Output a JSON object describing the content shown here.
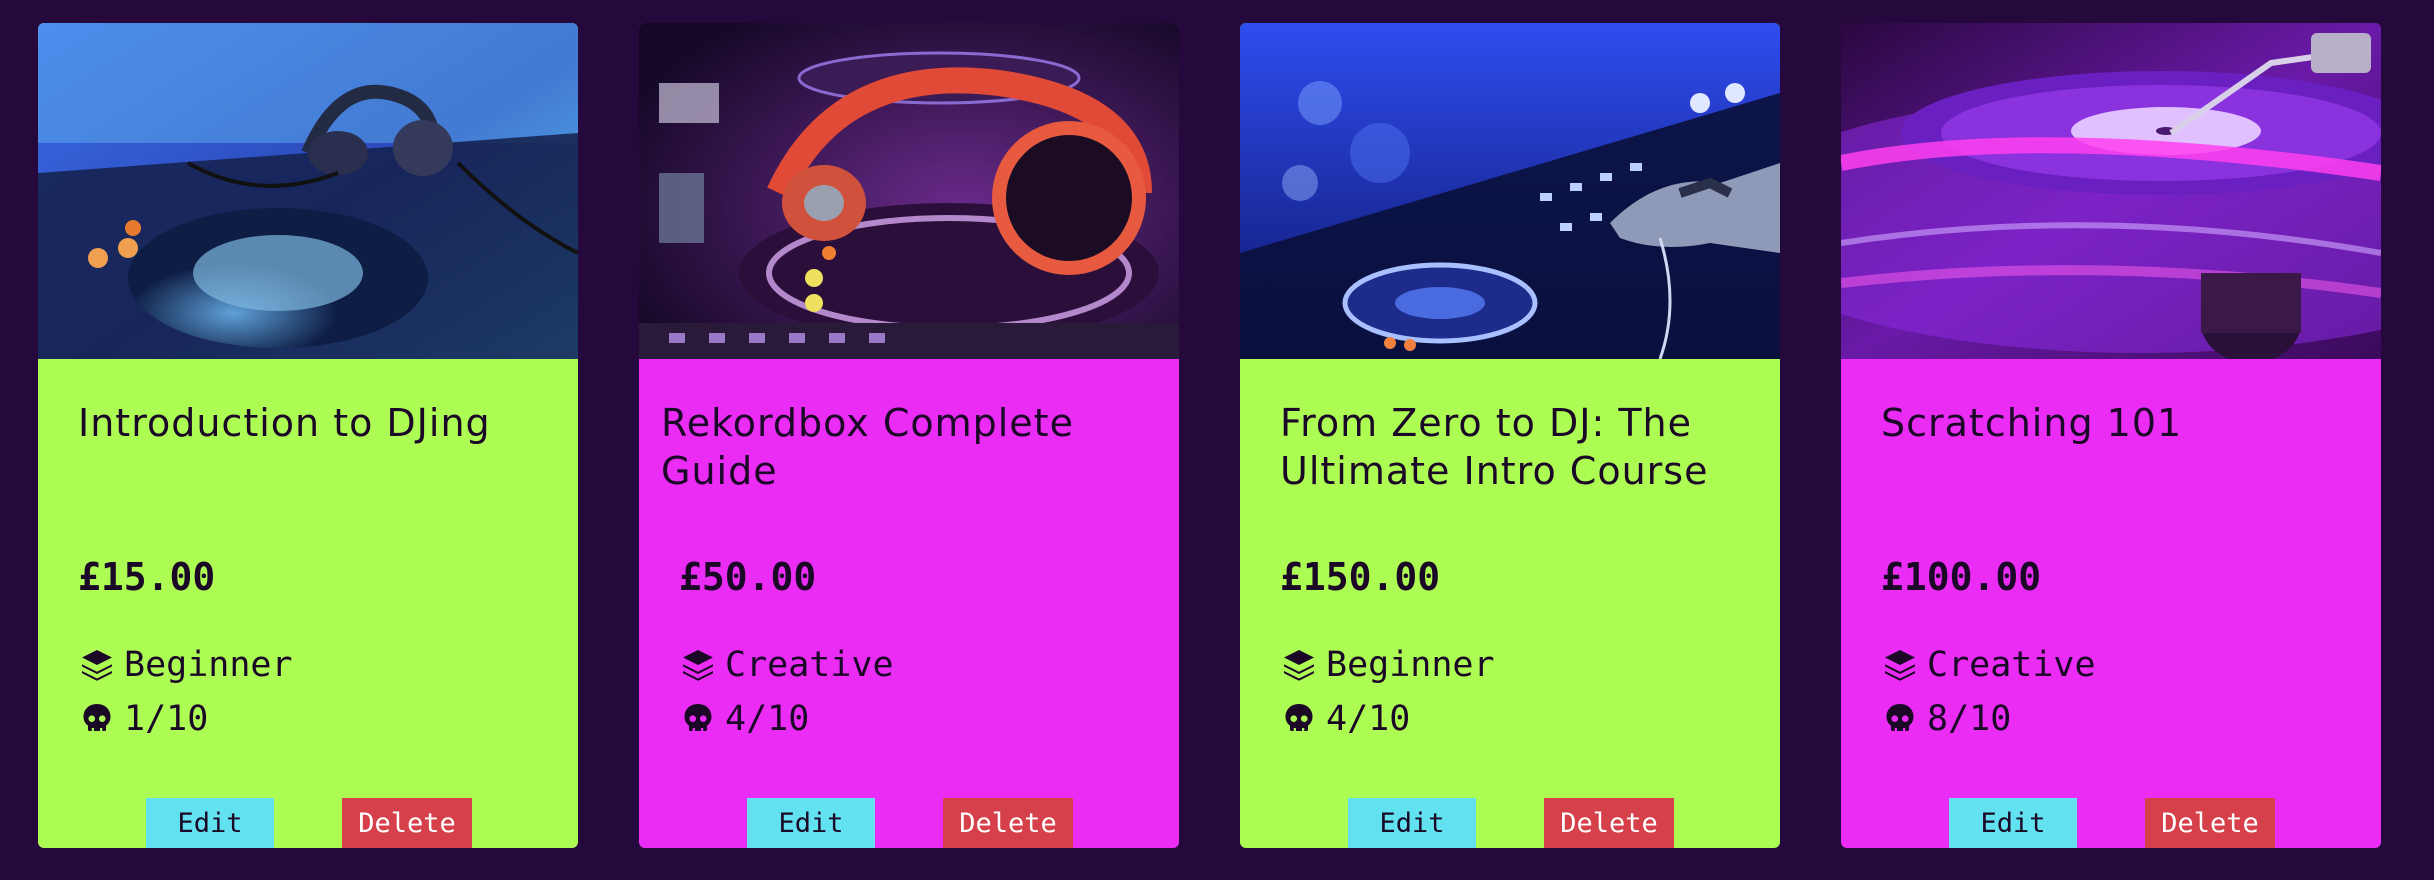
{
  "courses": [
    {
      "title": "Introduction to DJing",
      "price": "£15.00",
      "level": "Beginner",
      "difficulty": "1/10",
      "edit_label": "Edit",
      "delete_label": "Delete",
      "image_icon": "dj-controller-headphones-image",
      "card_color": "#adfc53"
    },
    {
      "title": "Rekordbox Complete Guide",
      "price": "£50.00",
      "level": "Creative",
      "difficulty": "4/10",
      "edit_label": "Edit",
      "delete_label": "Delete",
      "image_icon": "red-headphones-on-deck-image",
      "card_color": "#ea2cf5"
    },
    {
      "title": "From Zero to DJ: The Ultimate Intro Course",
      "price": "£150.00",
      "level": "Beginner",
      "difficulty": "4/10",
      "edit_label": "Edit",
      "delete_label": "Delete",
      "image_icon": "hand-on-mixer-image",
      "card_color": "#adfc53"
    },
    {
      "title": "Scratching 101",
      "price": "£100.00",
      "level": "Creative",
      "difficulty": "8/10",
      "edit_label": "Edit",
      "delete_label": "Delete",
      "image_icon": "turntable-vinyl-image",
      "card_color": "#ea2cf5"
    }
  ],
  "icons": {
    "level": "layers-icon",
    "difficulty": "skull-icon"
  },
  "colors": {
    "page_background": "#25093c",
    "edit_button": "#62e2f0",
    "delete_button": "#d5404a"
  }
}
